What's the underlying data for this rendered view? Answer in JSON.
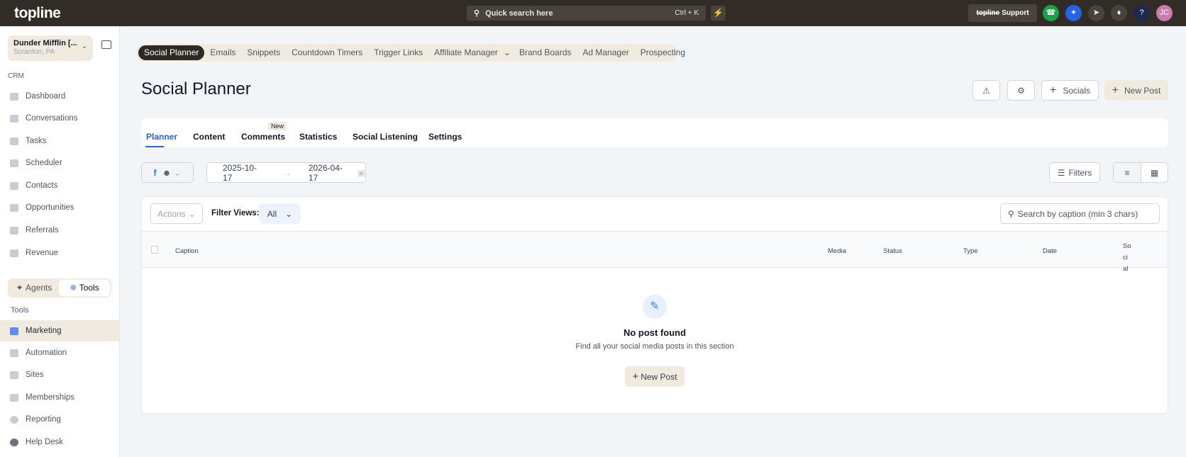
{
  "topbar": {
    "logo": "topline",
    "search_placeholder": "Quick search here",
    "search_shortcut": "Ctrl + K",
    "support_brand": "topline",
    "support_label": "Support",
    "avatar_initials": "JC"
  },
  "sidebar": {
    "account_name": "Dunder Mifflin [...",
    "account_location": "Scranton, PA",
    "crm_label": "CRM",
    "crm_items": [
      "Dashboard",
      "Conversations",
      "Tasks",
      "Scheduler",
      "Contacts",
      "Opportunities",
      "Referrals",
      "Revenue"
    ],
    "toggle": {
      "agents": "Agents",
      "tools": "Tools"
    },
    "tools_label": "Tools",
    "tool_items": [
      "Marketing",
      "Automation",
      "Sites",
      "Memberships",
      "Reporting",
      "Help Desk"
    ]
  },
  "subnav": [
    "Social Planner",
    "Emails",
    "Snippets",
    "Countdown Timers",
    "Trigger Links",
    "Affiliate Manager",
    "Brand Boards",
    "Ad Manager",
    "Prospecting"
  ],
  "page": {
    "title": "Social Planner",
    "socials_label": "Socials",
    "new_post_label": "New Post"
  },
  "tabs": {
    "items": [
      "Planner",
      "Content",
      "Comments",
      "Statistics",
      "Social Listening",
      "Settings"
    ],
    "new_badge": "New"
  },
  "filters": {
    "date_from": "2025-10-17",
    "date_to": "2026-04-17",
    "filters_label": "Filters"
  },
  "table": {
    "actions_label": "Actions",
    "filter_views_label": "Filter Views:",
    "filter_view_value": "All",
    "search_placeholder": "Search by caption (min 3 chars)",
    "columns": [
      "Caption",
      "Media",
      "Status",
      "Type",
      "Date",
      "Soci al"
    ]
  },
  "empty": {
    "title": "No post found",
    "subtitle": "Find all your social media posts in this section",
    "button": "New Post"
  }
}
